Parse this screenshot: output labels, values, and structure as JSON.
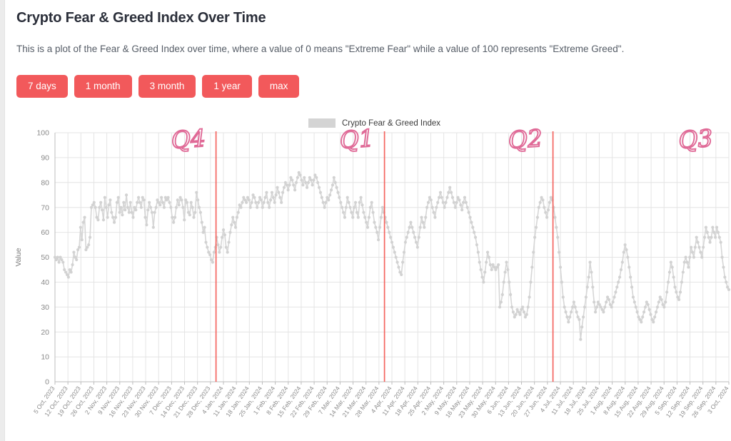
{
  "page": {
    "title": "Crypto Fear & Greed Index Over Time",
    "subtitle": "This is a plot of the Fear & Greed Index over time, where a value of 0 means \"Extreme Fear\" while a value of 100 represents \"Extreme Greed\".",
    "accent_color": "#f2595b",
    "series_color": "#d4d4d4",
    "annotation_color": "#e06a97",
    "divider_color": "#f4645f"
  },
  "range_buttons": [
    {
      "label": "7 days",
      "name": "range-7-days"
    },
    {
      "label": "1 month",
      "name": "range-1-month"
    },
    {
      "label": "3 month",
      "name": "range-3-month"
    },
    {
      "label": "1 year",
      "name": "range-1-year"
    },
    {
      "label": "max",
      "name": "range-max"
    }
  ],
  "legend": {
    "label": "Crypto Fear & Greed Index"
  },
  "annotations": [
    {
      "text": "Q4",
      "x_date": "2023-12-31"
    },
    {
      "text": "Q1",
      "x_date": "2024-03-31"
    },
    {
      "text": "Q2",
      "x_date": "2024-06-30"
    },
    {
      "text": "Q3",
      "x_date": "2024-09-30"
    }
  ],
  "chart_data": {
    "type": "line",
    "title": "Crypto Fear & Greed Index Over Time",
    "xlabel": "",
    "ylabel": "Value",
    "ylim": [
      0,
      100
    ],
    "ytick_step": 10,
    "yticks": [
      0,
      10,
      20,
      30,
      40,
      50,
      60,
      70,
      80,
      90,
      100
    ],
    "grid": true,
    "legend_position": "top-center",
    "x_start": "2023-10-05",
    "x_end": "2024-10-03",
    "x_tick_interval_days": 7,
    "xticks": [
      "5 Oct, 2023",
      "12 Oct, 2023",
      "19 Oct, 2023",
      "26 Oct, 2023",
      "2 Nov, 2023",
      "9 Nov, 2023",
      "16 Nov, 2023",
      "23 Nov, 2023",
      "30 Nov, 2023",
      "7 Dec, 2023",
      "14 Dec, 2023",
      "21 Dec, 2023",
      "28 Dec, 2023",
      "4 Jan, 2024",
      "11 Jan, 2024",
      "18 Jan, 2024",
      "25 Jan, 2024",
      "1 Feb, 2024",
      "8 Feb, 2024",
      "15 Feb, 2024",
      "22 Feb, 2024",
      "29 Feb, 2024",
      "7 Mar, 2024",
      "14 Mar, 2024",
      "21 Mar, 2024",
      "28 Mar, 2024",
      "4 Apr, 2024",
      "11 Apr, 2024",
      "18 Apr, 2024",
      "25 Apr, 2024",
      "2 May, 2024",
      "9 May, 2024",
      "16 May, 2024",
      "23 May, 2024",
      "30 May, 2024",
      "6 Jun, 2024",
      "13 Jun, 2024",
      "20 Jun, 2024",
      "27 Jun, 2024",
      "4 Jul, 2024",
      "11 Jul, 2024",
      "18 Jul, 2024",
      "25 Jul, 2024",
      "1 Aug, 2024",
      "8 Aug, 2024",
      "15 Aug, 2024",
      "22 Aug, 2024",
      "29 Aug, 2024",
      "5 Sep, 2024",
      "12 Sep, 2024",
      "19 Sep, 2024",
      "26 Sep, 2024",
      "3 Oct, 2024"
    ],
    "series": [
      {
        "name": "Crypto Fear & Greed Index",
        "color": "#d4d4d4",
        "values": [
          50,
          49,
          50,
          48,
          50,
          49,
          48,
          45,
          44,
          43,
          42,
          45,
          44,
          47,
          52,
          50,
          49,
          53,
          54,
          62,
          57,
          64,
          66,
          53,
          54,
          55,
          58,
          70,
          71,
          72,
          70,
          66,
          65,
          70,
          72,
          69,
          65,
          74,
          70,
          66,
          71,
          73,
          68,
          66,
          64,
          66,
          72,
          74,
          68,
          70,
          67,
          72,
          69,
          75,
          70,
          68,
          72,
          68,
          66,
          70,
          69,
          72,
          74,
          72,
          70,
          74,
          73,
          66,
          63,
          69,
          72,
          70,
          68,
          62,
          68,
          70,
          73,
          72,
          71,
          74,
          72,
          70,
          74,
          73,
          74,
          72,
          70,
          66,
          64,
          66,
          70,
          73,
          71,
          74,
          73,
          70,
          65,
          73,
          72,
          68,
          67,
          72,
          70,
          66,
          68,
          76,
          73,
          70,
          68,
          64,
          60,
          62,
          56,
          54,
          52,
          51,
          49,
          48,
          52,
          54,
          58,
          55,
          52,
          54,
          58,
          61,
          59,
          54,
          52,
          56,
          60,
          63,
          66,
          64,
          62,
          66,
          68,
          71,
          70,
          72,
          74,
          73,
          72,
          74,
          73,
          70,
          72,
          75,
          74,
          72,
          70,
          72,
          74,
          73,
          70,
          72,
          74,
          76,
          72,
          70,
          73,
          76,
          74,
          72,
          75,
          78,
          76,
          74,
          72,
          76,
          78,
          80,
          79,
          77,
          79,
          82,
          81,
          79,
          77,
          80,
          82,
          84,
          83,
          81,
          79,
          82,
          80,
          78,
          80,
          82,
          81,
          79,
          81,
          83,
          82,
          80,
          78,
          76,
          74,
          72,
          70,
          72,
          74,
          73,
          75,
          77,
          79,
          82,
          80,
          78,
          76,
          74,
          72,
          70,
          68,
          66,
          70,
          74,
          72,
          70,
          68,
          66,
          70,
          72,
          68,
          66,
          72,
          74,
          71,
          68,
          66,
          64,
          62,
          66,
          70,
          72,
          68,
          64,
          62,
          60,
          57,
          62,
          66,
          70,
          68,
          66,
          64,
          62,
          60,
          58,
          56,
          54,
          52,
          50,
          48,
          46,
          44,
          43,
          48,
          52,
          56,
          58,
          60,
          62,
          64,
          62,
          60,
          58,
          56,
          54,
          58,
          62,
          66,
          64,
          62,
          66,
          70,
          72,
          74,
          73,
          70,
          68,
          66,
          70,
          72,
          74,
          76,
          74,
          72,
          70,
          72,
          74,
          76,
          78,
          76,
          74,
          72,
          70,
          72,
          74,
          73,
          71,
          69,
          72,
          74,
          72,
          70,
          68,
          66,
          64,
          62,
          60,
          58,
          55,
          52,
          48,
          45,
          42,
          40,
          44,
          48,
          52,
          50,
          47,
          45,
          47,
          46,
          45,
          46,
          47,
          30,
          32,
          35,
          40,
          44,
          48,
          45,
          40,
          35,
          30,
          28,
          26,
          27,
          29,
          28,
          27,
          29,
          30,
          28,
          26,
          27,
          30,
          34,
          40,
          46,
          52,
          58,
          62,
          66,
          70,
          72,
          74,
          73,
          70,
          68,
          66,
          69,
          72,
          74,
          73,
          70,
          66,
          62,
          58,
          52,
          46,
          40,
          34,
          30,
          28,
          26,
          24,
          26,
          28,
          30,
          32,
          30,
          28,
          26,
          25,
          17,
          22,
          26,
          30,
          34,
          38,
          42,
          48,
          44,
          38,
          32,
          28,
          30,
          32,
          31,
          30,
          29,
          28,
          30,
          32,
          34,
          33,
          31,
          30,
          32,
          34,
          36,
          38,
          40,
          42,
          45,
          48,
          52,
          55,
          53,
          50,
          46,
          42,
          38,
          34,
          32,
          30,
          28,
          26,
          25,
          24,
          26,
          28,
          30,
          32,
          31,
          29,
          27,
          25,
          24,
          26,
          28,
          30,
          32,
          34,
          33,
          31,
          30,
          32,
          36,
          40,
          44,
          48,
          46,
          42,
          38,
          36,
          34,
          33,
          36,
          40,
          44,
          48,
          50,
          48,
          46,
          50,
          54,
          52,
          50,
          54,
          58,
          56,
          54,
          52,
          50,
          54,
          58,
          62,
          60,
          58,
          56,
          58,
          62,
          60,
          58,
          62,
          60,
          58,
          56,
          50,
          46,
          42,
          40,
          38,
          37
        ]
      }
    ]
  }
}
